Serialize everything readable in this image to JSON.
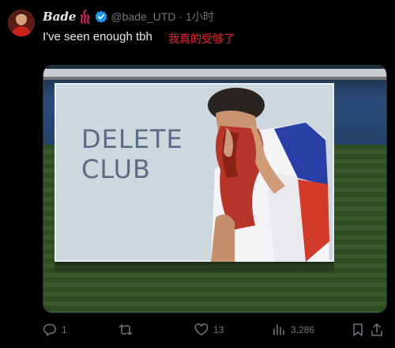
{
  "tweet": {
    "display_name": "Bade",
    "handle": "@bade_UTD",
    "separator": "·",
    "time": "1小时",
    "text": "I've seen enough tbh",
    "translation": "我真的受够了"
  },
  "media": {
    "sign_lines": [
      "DELETE",
      "CLUB"
    ]
  },
  "actions": {
    "replies": "1",
    "reposts": "",
    "likes": "13",
    "views": "3,286"
  },
  "colors": {
    "background": "#000000",
    "text": "#e7e9ea",
    "muted": "#71767b",
    "verified": "#1d9bf0",
    "translation": "#f4212e",
    "fire": "#e0245e"
  },
  "icons": [
    "fire-icon",
    "verified-icon",
    "reply-icon",
    "repost-icon",
    "like-icon",
    "views-icon",
    "bookmark-icon",
    "share-icon"
  ]
}
